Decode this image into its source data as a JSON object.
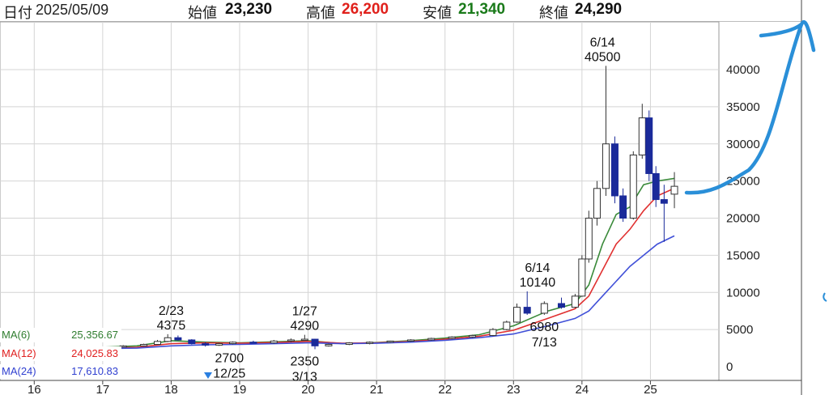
{
  "header": {
    "date_label": "日付",
    "date": "2025/05/09",
    "open_label": "始値",
    "open": "23,230",
    "high_label": "高値",
    "high": "26,200",
    "low_label": "安値",
    "low": "21,340",
    "close_label": "終値",
    "close": "24,290"
  },
  "colors": {
    "high": "#e0201b",
    "low": "#1a7a1a",
    "ma6": "#3a8a3a",
    "ma12": "#e03030",
    "ma24": "#4050d8",
    "candle_down": "#1a2a9a",
    "annotation_stroke": "#2a8fd8"
  },
  "ma_legend": [
    {
      "label": "MA(6)",
      "value": "25,356.67",
      "color": "#2f7d2f"
    },
    {
      "label": "MA(12)",
      "value": "24,025.83",
      "color": "#e02020"
    },
    {
      "label": "MA(24)",
      "value": "17,610.83",
      "color": "#3040d0"
    }
  ],
  "chart_data": {
    "type": "candlestick",
    "title": "",
    "xlabel": "",
    "ylabel": "",
    "ylim": [
      0,
      45000
    ],
    "y_ticks": [
      0,
      5000,
      10000,
      15000,
      20000,
      25000,
      30000,
      35000,
      40000
    ],
    "x_ticks": [
      "16",
      "17",
      "18",
      "19",
      "20",
      "21",
      "22",
      "23",
      "24",
      "25"
    ],
    "grid": true,
    "x_range": [
      15.5,
      26.0
    ],
    "candles": [
      [
        15.5,
        2400,
        2450,
        2300,
        2380
      ],
      [
        15.8,
        2380,
        2500,
        2350,
        2420
      ],
      [
        16.1,
        2420,
        2480,
        2380,
        2400
      ],
      [
        16.4,
        2400,
        2550,
        2380,
        2500
      ],
      [
        16.7,
        2500,
        2600,
        2450,
        2550
      ],
      [
        17.0,
        2550,
        2700,
        2500,
        2650
      ],
      [
        17.3,
        2650,
        2900,
        2600,
        2800
      ],
      [
        17.6,
        2800,
        3100,
        2750,
        3000
      ],
      [
        17.8,
        3000,
        3600,
        2950,
        3400
      ],
      [
        17.95,
        3400,
        4375,
        3300,
        3900
      ],
      [
        18.1,
        3900,
        4200,
        3500,
        3600
      ],
      [
        18.3,
        3600,
        3700,
        3000,
        3100
      ],
      [
        18.5,
        3100,
        3300,
        2700,
        2900
      ],
      [
        18.7,
        2900,
        3200,
        2800,
        3100
      ],
      [
        18.9,
        3100,
        3400,
        3000,
        3300
      ],
      [
        19.2,
        3300,
        3500,
        3100,
        3200
      ],
      [
        19.5,
        3200,
        3600,
        3100,
        3450
      ],
      [
        19.75,
        3450,
        3800,
        3300,
        3600
      ],
      [
        19.95,
        3600,
        4290,
        3500,
        3700
      ],
      [
        20.1,
        3700,
        3750,
        2350,
        2800
      ],
      [
        20.3,
        2800,
        3100,
        2700,
        3000
      ],
      [
        20.6,
        3000,
        3300,
        2900,
        3200
      ],
      [
        20.9,
        3200,
        3400,
        3000,
        3300
      ],
      [
        21.2,
        3300,
        3500,
        3200,
        3450
      ],
      [
        21.5,
        3450,
        3700,
        3350,
        3600
      ],
      [
        21.8,
        3600,
        3900,
        3500,
        3800
      ],
      [
        22.1,
        3800,
        4100,
        3700,
        4000
      ],
      [
        22.4,
        4000,
        4300,
        3900,
        4200
      ],
      [
        22.7,
        4200,
        5200,
        4100,
        5000
      ],
      [
        22.9,
        5000,
        6200,
        4900,
        6000
      ],
      [
        23.05,
        6000,
        8500,
        5900,
        8000
      ],
      [
        23.2,
        8000,
        10140,
        6980,
        7200
      ],
      [
        23.45,
        7200,
        8800,
        6980,
        8500
      ],
      [
        23.7,
        8500,
        9300,
        7800,
        8000
      ],
      [
        23.9,
        8000,
        9800,
        7900,
        9500
      ],
      [
        24.0,
        9500,
        15000,
        9400,
        14500
      ],
      [
        24.1,
        14500,
        21000,
        14000,
        20000
      ],
      [
        24.22,
        20000,
        25000,
        19000,
        24000
      ],
      [
        24.35,
        24000,
        40500,
        23000,
        30000
      ],
      [
        24.48,
        30000,
        31000,
        22000,
        23000
      ],
      [
        24.6,
        23000,
        24000,
        19500,
        20000
      ],
      [
        24.75,
        20000,
        29000,
        19800,
        28500
      ],
      [
        24.88,
        28500,
        35400,
        28000,
        33500
      ],
      [
        24.98,
        33500,
        34500,
        25000,
        26000
      ],
      [
        25.08,
        26000,
        27000,
        21500,
        22500
      ],
      [
        25.2,
        22500,
        24500,
        16800,
        22000
      ],
      [
        25.35,
        23230,
        26200,
        21340,
        24290
      ]
    ],
    "series": [
      {
        "name": "MA(6)",
        "x": [
          15.5,
          16.5,
          17.5,
          18.0,
          18.5,
          19.0,
          19.5,
          20.0,
          20.5,
          21.0,
          21.5,
          22.0,
          22.5,
          23.0,
          23.5,
          23.9,
          24.1,
          24.3,
          24.5,
          24.7,
          24.9,
          25.1,
          25.35
        ],
        "values": [
          2400,
          2450,
          2800,
          3500,
          3300,
          3200,
          3350,
          3500,
          3100,
          3250,
          3500,
          3850,
          4300,
          5500,
          7500,
          8500,
          11000,
          16500,
          20500,
          21500,
          24500,
          25000,
          25356.67
        ]
      },
      {
        "name": "MA(12)",
        "x": [
          15.5,
          16.5,
          17.5,
          18.0,
          18.5,
          19.0,
          19.5,
          20.0,
          20.5,
          21.0,
          21.5,
          22.0,
          22.5,
          23.0,
          23.5,
          23.9,
          24.1,
          24.3,
          24.5,
          24.7,
          24.9,
          25.1,
          25.35
        ],
        "values": [
          2400,
          2420,
          2600,
          3100,
          3200,
          3150,
          3250,
          3400,
          3150,
          3200,
          3400,
          3700,
          4100,
          4900,
          6500,
          7800,
          9500,
          13000,
          16500,
          18500,
          21000,
          23000,
          24025.83
        ]
      },
      {
        "name": "MA(24)",
        "x": [
          15.5,
          16.5,
          17.5,
          18.0,
          18.5,
          19.0,
          19.5,
          20.0,
          20.5,
          21.0,
          21.5,
          22.0,
          22.5,
          23.0,
          23.5,
          23.9,
          24.1,
          24.3,
          24.5,
          24.7,
          24.9,
          25.1,
          25.35
        ],
        "values": [
          2400,
          2400,
          2500,
          2800,
          2950,
          3000,
          3100,
          3200,
          3100,
          3150,
          3300,
          3550,
          3900,
          4400,
          5500,
          6500,
          7500,
          9500,
          11500,
          13500,
          15000,
          16500,
          17610.83
        ]
      }
    ],
    "annotations": [
      {
        "x": 18.0,
        "y_top": "2/23",
        "y_bottom": "4375",
        "position": "above"
      },
      {
        "x": 19.95,
        "y_top": "1/27",
        "y_bottom": "4290",
        "position": "above"
      },
      {
        "x": 18.85,
        "y_top": "2700",
        "y_bottom": "12/25",
        "position": "below"
      },
      {
        "x": 19.95,
        "y_top": "2350",
        "y_bottom": "3/13",
        "position": "below"
      },
      {
        "x": 23.35,
        "y_top": "6/14",
        "y_bottom": "10140",
        "position": "above"
      },
      {
        "x": 23.45,
        "y_top": "6980",
        "y_bottom": "7/13",
        "position": "below"
      },
      {
        "x": 24.3,
        "y_top": "6/14",
        "y_bottom": "40500",
        "position": "above"
      }
    ],
    "legend": "bottom-left"
  }
}
